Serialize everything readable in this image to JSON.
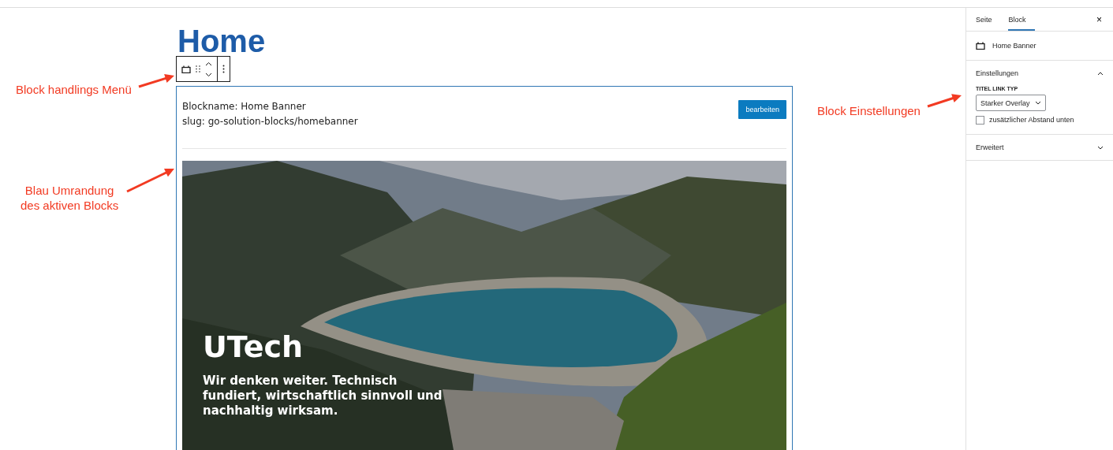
{
  "page_title": "Home",
  "toolbar": {
    "buttons": [
      {
        "kind": "block-type"
      },
      {
        "kind": "drag"
      },
      {
        "kind": "move"
      },
      {
        "kind": "more"
      }
    ]
  },
  "block": {
    "selected": true,
    "info_lines": [
      "Blockname: Home Banner",
      "slug: go-solution-blocks/homebanner"
    ],
    "edit_button": "bearbeiten",
    "banner": {
      "kind": "picture",
      "heading": "UTech",
      "tagline": "Wir denken weiter. Technisch fundiert, wirtschaftlich sinnvoll und nachhaltig wirksam."
    }
  },
  "annotations": [
    {
      "kind": "toolbar",
      "text": "Block handlings Menü"
    },
    {
      "kind": "border",
      "text": "Blau Umrandung\ndes aktiven Blocks"
    },
    {
      "kind": "settings",
      "text": "Block Einstellungen"
    }
  ],
  "sidebar": {
    "tabs": [
      {
        "label": "Seite",
        "selected": false
      },
      {
        "label": "Block",
        "selected": true
      }
    ],
    "close": "×",
    "block_name": "Home Banner",
    "panels": [
      {
        "title": "Einstellungen",
        "expanded": true,
        "field_label": "TITEL LINK TYP",
        "select_value": "Starker Overlay",
        "checkbox": {
          "label": "zusätzlicher Abstand unten",
          "checked": false
        }
      },
      {
        "title": "Erweitert",
        "expanded": false
      }
    ]
  }
}
